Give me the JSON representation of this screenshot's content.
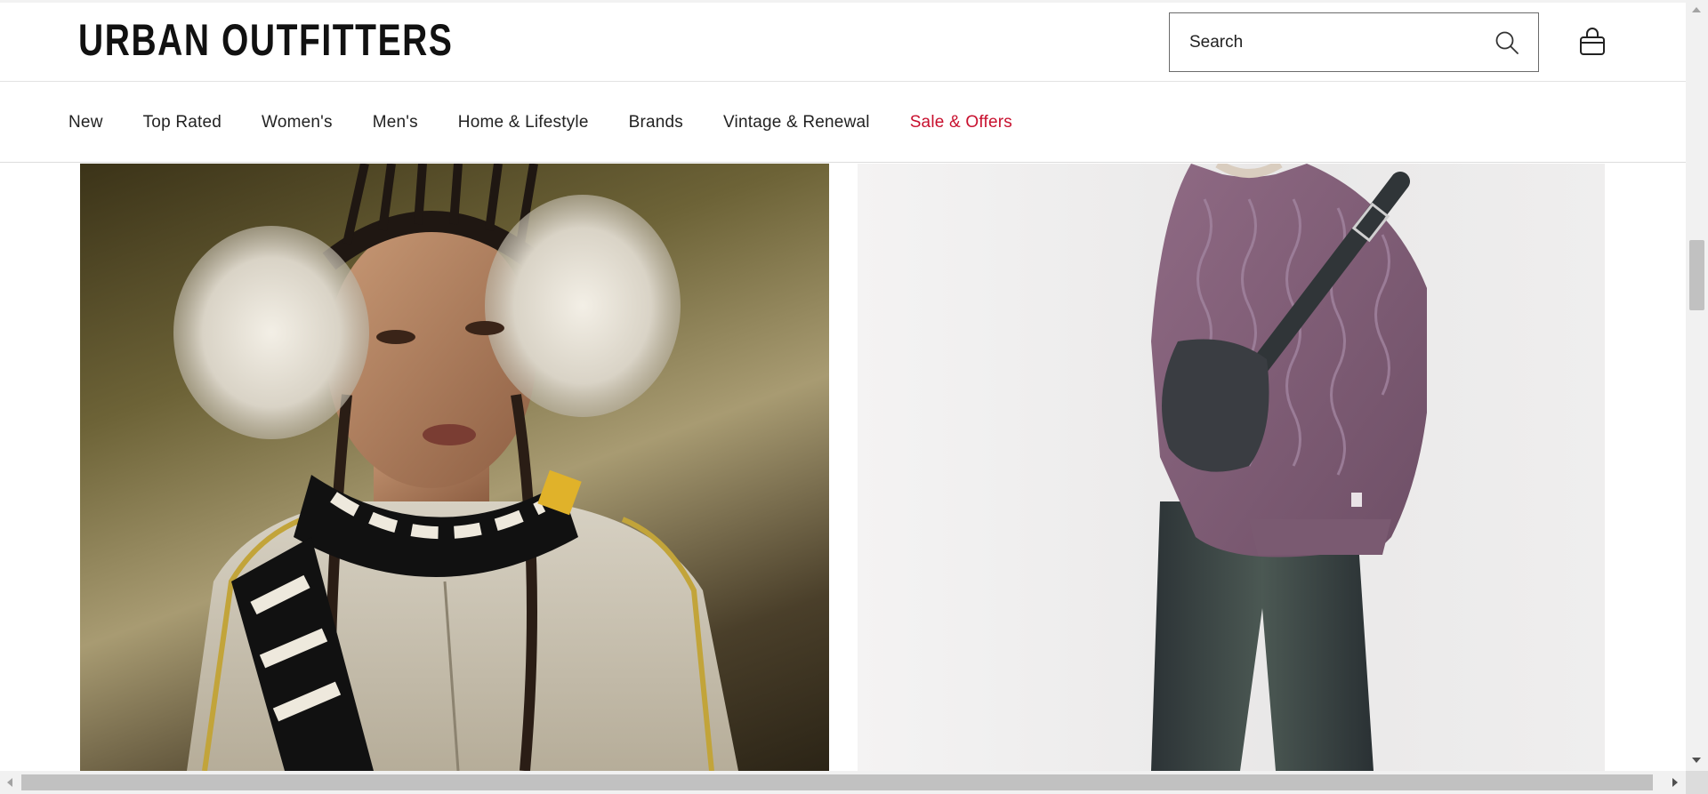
{
  "header": {
    "logo_text": "URBAN OUTFITTERS",
    "search": {
      "placeholder": "Search",
      "value": ""
    },
    "icons": {
      "search": "search-icon",
      "bag": "shopping-bag-icon"
    }
  },
  "nav": {
    "items": [
      {
        "label": "New",
        "color": "#222222"
      },
      {
        "label": "Top Rated",
        "color": "#222222"
      },
      {
        "label": "Women's",
        "color": "#222222"
      },
      {
        "label": "Men's",
        "color": "#222222"
      },
      {
        "label": "Home & Lifestyle",
        "color": "#222222"
      },
      {
        "label": "Brands",
        "color": "#222222"
      },
      {
        "label": "Vintage & Renewal",
        "color": "#222222"
      },
      {
        "label": "Sale & Offers",
        "color": "#c8102e"
      }
    ]
  },
  "content": {
    "tiles": [
      {
        "name": "womens-editorial-image",
        "subject": "model with fur earmuffs, braids and striped scarf"
      },
      {
        "name": "mens-editorial-image",
        "subject": "model in purple cable-knit sweater, crossbody bag and dark jeans"
      }
    ]
  },
  "scrollbars": {
    "vertical_position": 0.28,
    "horizontal_position": 0.0
  }
}
